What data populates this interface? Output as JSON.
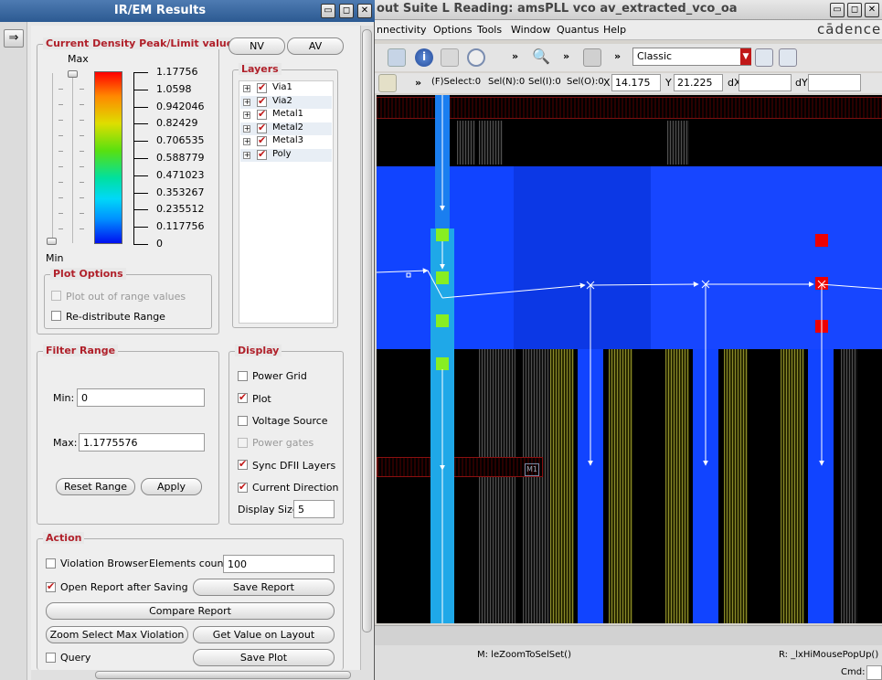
{
  "irem": {
    "title": "IR/EM Results",
    "window_buttons": [
      "▭",
      "◻",
      "✕"
    ],
    "nv_label": "NV",
    "av_label": "AV",
    "density_group_title": "Current Density Peak/Limit values",
    "max_label": "Max",
    "min_label": "Min",
    "scale_values": [
      "1.17756",
      "1.0598",
      "0.942046",
      "0.82429",
      "0.706535",
      "0.588779",
      "0.471023",
      "0.353267",
      "0.235512",
      "0.117756",
      "0"
    ],
    "layers_title": "Layers",
    "layers": [
      {
        "name": "Via1",
        "checked": true
      },
      {
        "name": "Via2",
        "checked": true
      },
      {
        "name": "Metal1",
        "checked": true
      },
      {
        "name": "Metal2",
        "checked": true
      },
      {
        "name": "Metal3",
        "checked": true
      },
      {
        "name": "Poly",
        "checked": true
      }
    ],
    "plot_options_title": "Plot Options",
    "plot_out_of_range": "Plot out of range values",
    "redistribute_range": "Re-distribute Range",
    "filter_title": "Filter Range",
    "min_field_label": "Min:",
    "min_value": "0",
    "max_field_label": "Max:",
    "max_value": "1.1775576",
    "reset_range": "Reset Range",
    "apply": "Apply",
    "display_title": "Display",
    "display_power_grid": "Power Grid",
    "display_plot": "Plot",
    "display_voltage_source": "Voltage Source",
    "display_power_gates": "Power gates",
    "display_sync_layers": "Sync DFII Layers",
    "display_current_direction": "Current Direction",
    "display_size_label": "Display Size",
    "display_size_value": "5",
    "action_title": "Action",
    "violation_browser": "Violation Browser",
    "elements_count_label": "Elements count",
    "elements_count_value": "100",
    "open_report": "Open Report after Saving",
    "save_report": "Save Report",
    "compare_report": "Compare Report",
    "zoom_max_violation": "Zoom Select Max Violation",
    "get_value_layout": "Get Value on Layout",
    "query": "Query",
    "save_plot": "Save Plot"
  },
  "layout": {
    "title": "out Suite L Reading: amsPLL vco av_extracted_vco_oa",
    "brand": "cādence",
    "menus": [
      "nnectivity",
      "Options",
      "Tools",
      "Window",
      "Quantus",
      "Help"
    ],
    "mode_select": "Classic",
    "status_fields": [
      "(F)Select:0",
      "Sel(N):0",
      "Sel(I):0",
      "Sel(O):0"
    ],
    "x_label": "X",
    "x_value": "14.175",
    "y_label": "Y",
    "y_value": "21.225",
    "dx_label": "dX",
    "dy_label": "dY",
    "mouse_left": "M: leZoomToSelSet()",
    "mouse_right": "R: _lxHiMousePopUp()",
    "cmd_label": "Cmd:",
    "via_label": "M1",
    "colors": {
      "metal": "#1144ff",
      "highlight": "#1fa8e8",
      "via_green": "#88ee22",
      "via_red": "#ee0000"
    }
  }
}
